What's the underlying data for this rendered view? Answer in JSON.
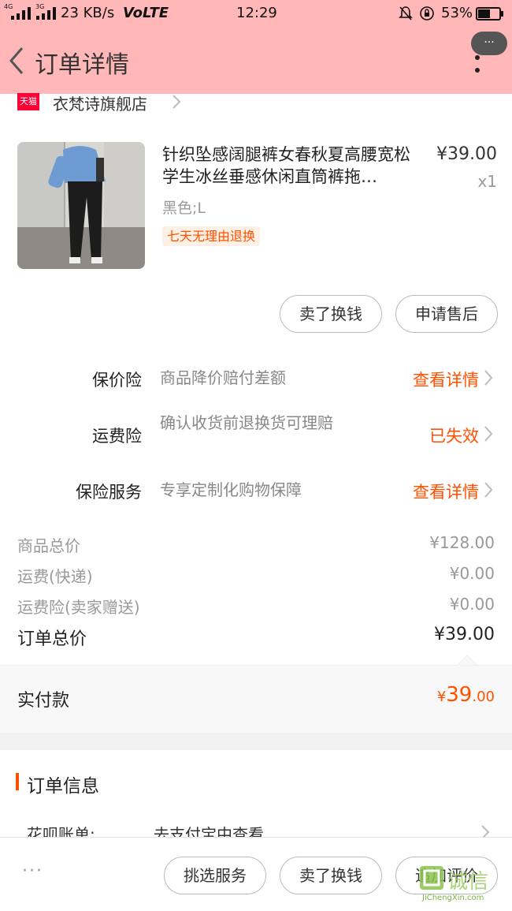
{
  "status_bar": {
    "signal_left": "4G",
    "signal_right": "3G",
    "speed": "23 KB/s",
    "carrier": "VoLTE",
    "time": "12:29",
    "battery": "53%"
  },
  "nav": {
    "title": "订单详情",
    "more_label": "···"
  },
  "shop": {
    "badge": "天猫",
    "name": "衣梵诗旗舰店"
  },
  "product": {
    "title": "针织坠感阔腿裤女春秋夏高腰宽松学生冰丝垂感休闲直筒裤拖…",
    "price": "¥39.00",
    "qty": "x1",
    "sku": "黑色;L",
    "tag": "七天无理由退换"
  },
  "item_actions": {
    "sell": "卖了换钱",
    "after_sale": "申请售后"
  },
  "insurance": [
    {
      "label": "保价险",
      "desc": "商品降价赔付差额",
      "action": "查看详情"
    },
    {
      "label": "运费险",
      "desc": "确认收货前退换货可理赔",
      "action": "已失效"
    },
    {
      "label": "保险服务",
      "desc": "专享定制化购物保障",
      "action": "查看详情"
    }
  ],
  "summary": {
    "goods_label": "商品总价",
    "goods_value": "¥128.00",
    "shipping_label": "运费(快递)",
    "shipping_value": "¥0.00",
    "ship_ins_label": "运费险(卖家赠送)",
    "ship_ins_value": "¥0.00",
    "order_label": "订单总价",
    "order_value": "¥39.00"
  },
  "paid": {
    "label": "实付款",
    "currency": "¥",
    "integer": "39",
    "decimal": ".00"
  },
  "order_info": {
    "heading": "订单信息",
    "huabei_label": "花呗账单:",
    "huabei_value": "去支付宝中查看"
  },
  "footer": {
    "more": "···",
    "pick_service": "挑选服务",
    "sell": "卖了换钱",
    "add_review": "追加评价"
  },
  "watermark": {
    "text": "诚信",
    "domain": "JiChengXin.com"
  },
  "colors": {
    "header_bg": "#ffb7b7",
    "accent": "#ff5000",
    "tmall_red": "#ff0036"
  }
}
